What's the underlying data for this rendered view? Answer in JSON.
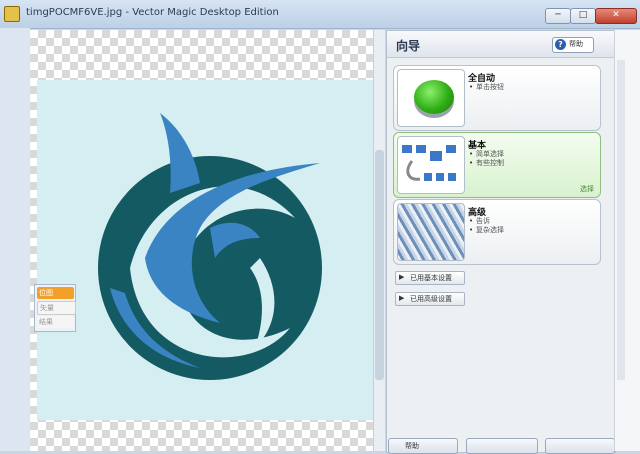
{
  "window": {
    "title": "timgPOCMF6VE.jpg - Vector Magic Desktop Edition",
    "min_label": "─",
    "max_label": "□",
    "close_label": "✕"
  },
  "nav": {
    "up": "∧",
    "down": "∨",
    "left": "<",
    "right": ">",
    "fit": "⊠",
    "zoom": "⊞"
  },
  "mode": {
    "active_label": "位图",
    "dim1_label": "矢量",
    "dim2_label": "结果"
  },
  "wizard": {
    "title": "向导",
    "help_label": "帮助",
    "cards": [
      {
        "title": "全自动",
        "bullets": [
          "单击按钮"
        ],
        "tag": ""
      },
      {
        "title": "基本",
        "bullets": [
          "简单选择",
          "有些控制"
        ],
        "tag": "选择"
      },
      {
        "title": "高级",
        "bullets": [
          "告诉",
          "复杂选择"
        ],
        "tag": ""
      }
    ],
    "options": [
      "已用基本设置",
      "已用高级设置"
    ],
    "footer": [
      "帮助",
      "",
      ""
    ]
  },
  "colors": {
    "sky": "#d4eef1",
    "marlin": "#3a84c4",
    "circle": "#145a63",
    "accent": "#f2a02a"
  }
}
